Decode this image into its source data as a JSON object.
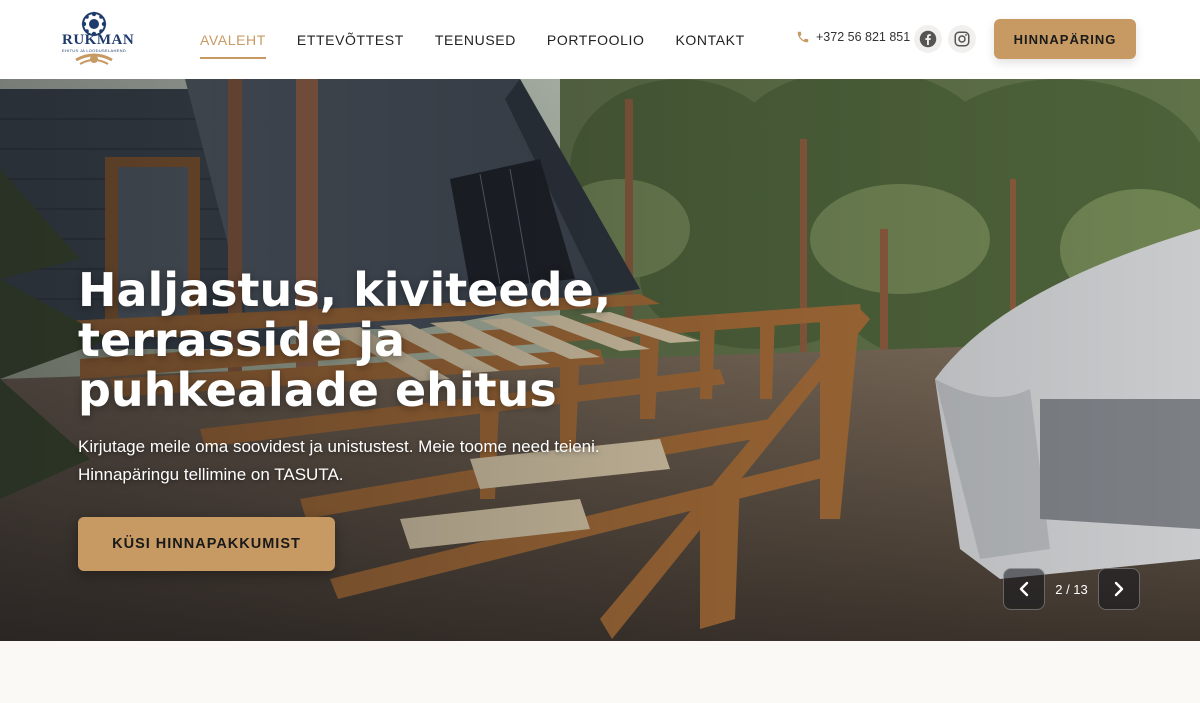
{
  "header": {
    "logo": {
      "name": "RUKMAN",
      "tagline": "EHITUS JA LOODUSELAHENDUSED",
      "primary_color": "#1f3b6e",
      "accent_color": "#c79a63"
    },
    "nav": [
      {
        "label": "AVALEHT",
        "active": true
      },
      {
        "label": "ETTEVÕTTEST",
        "active": false
      },
      {
        "label": "TEENUSED",
        "active": false
      },
      {
        "label": "PORTFOOLIO",
        "active": false
      },
      {
        "label": "KONTAKT",
        "active": false
      }
    ],
    "phone": "+372 56 821 851",
    "social": [
      {
        "icon": "facebook-icon"
      },
      {
        "icon": "instagram-icon"
      }
    ],
    "cta_label": "HINNAPÄRING"
  },
  "hero": {
    "title": "Haljastus, kiviteede, terrasside ja puhkealade ehitus",
    "subtitle_line1": "Kirjutage meile oma soovidest ja unistustest. Meie toome need teieni.",
    "subtitle_line2": "Hinnapäringu tellimine on TASUTA.",
    "cta_label": "KÜSI HINNAPAKKUMIST",
    "slider": {
      "prev_icon": "chevron-left-icon",
      "next_icon": "chevron-right-icon",
      "counter": "2 / 13"
    }
  },
  "colors": {
    "accent": "#c79a63",
    "nav_text": "#222222",
    "hero_text": "#ffffff",
    "page_bg": "#faf9f6"
  }
}
